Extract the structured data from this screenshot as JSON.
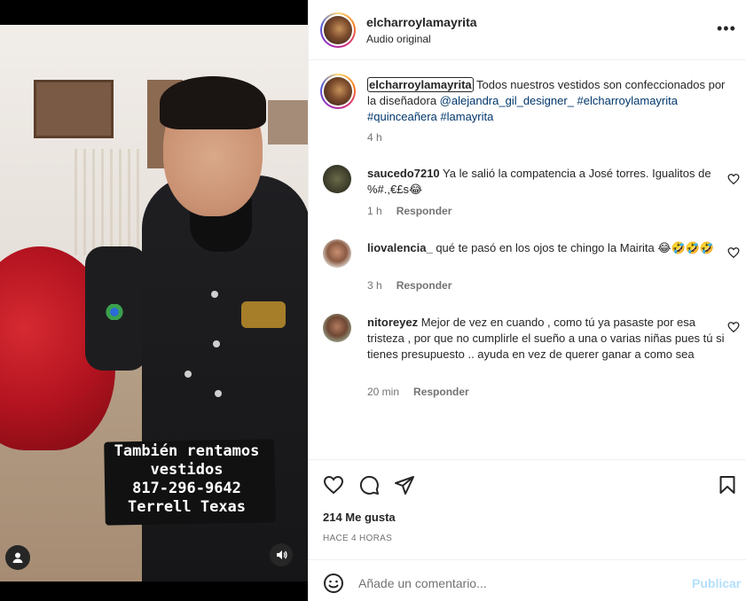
{
  "video": {
    "caption_lines": [
      "También rentamos",
      "vestidos",
      "817-296-9642",
      "Terrell Texas"
    ]
  },
  "header": {
    "username": "elcharroylamayrita",
    "subtitle": "Audio original",
    "more_icon": "more-horizontal-icon"
  },
  "post": {
    "username": "elcharroylamayrita",
    "text": " Todos nuestros vestidos son confeccionados por la diseñadora ",
    "mention": "@alejandra_gil_designer_",
    "hashtags": "#elcharroylamayrita #quinceañera #lamayrita",
    "time": "4 h"
  },
  "comments": [
    {
      "user": "saucedo7210",
      "text": " Ya le salió la compatencia a José torres. Igualitos de %#.,€£s😂",
      "time": "1 h",
      "reply": "Responder"
    },
    {
      "user": "liovalencia_",
      "text": " qué te pasó en los ojos te chingo la Mairita 😂🤣🤣🤣",
      "time": "3 h",
      "reply": "Responder"
    },
    {
      "user": "nitoreyez",
      "text": " Mejor de vez en cuando , como tú ya pasaste por esa tristeza , por que no cumplirle el sueño a una o varias niñas pues tú si tienes presupuesto .. ayuda en vez de querer ganar a como sea",
      "time": "20 min",
      "reply": "Responder"
    }
  ],
  "actions": {
    "likes": "214 Me gusta",
    "posted": "HACE 4 HORAS",
    "icons": [
      "heart-icon",
      "comment-icon",
      "share-icon",
      "save-icon"
    ]
  },
  "composer": {
    "placeholder": "Añade un comentario...",
    "publish": "Publicar"
  }
}
